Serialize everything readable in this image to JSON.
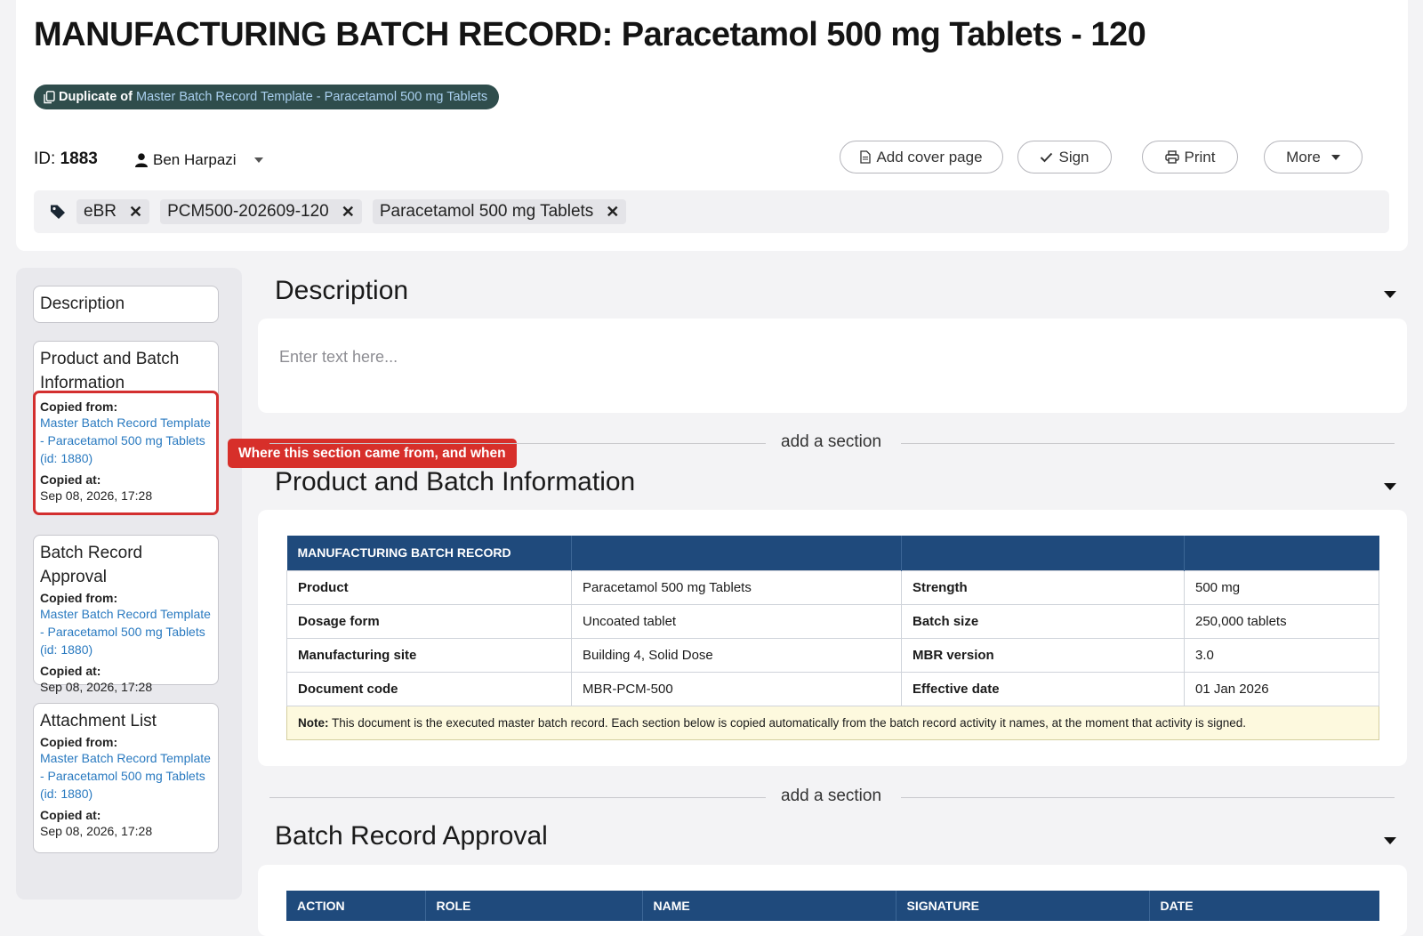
{
  "header": {
    "title": "MANUFACTURING BATCH RECORD: Paracetamol 500 mg Tablets - 120",
    "duplicate_prefix": "Duplicate of",
    "duplicate_link": "Master Batch Record Template - Paracetamol 500 mg Tablets",
    "id_label": "ID:",
    "id_value": "1883",
    "owner": "Ben Harpazi"
  },
  "toolbar": {
    "add_cover": "Add cover page",
    "sign": "Sign",
    "print": "Print",
    "more": "More"
  },
  "tags": [
    "eBR",
    "PCM500-202609-120",
    "Paracetamol 500 mg Tablets"
  ],
  "sidebar": {
    "items": [
      {
        "title": "Description"
      },
      {
        "title": "Product and Batch Information",
        "copied_from_label": "Copied from:",
        "source": "Master Batch Record Template - Paracetamol 500 mg Tablets (id: 1880)",
        "copied_at_label": "Copied at:",
        "copied_at": "Sep 08, 2026, 17:28"
      },
      {
        "title": "Batch Record Approval",
        "copied_from_label": "Copied from:",
        "source": "Master Batch Record Template - Paracetamol 500 mg Tablets (id: 1880)",
        "copied_at_label": "Copied at:",
        "copied_at": "Sep 08, 2026, 17:28"
      },
      {
        "title": "Attachment List",
        "copied_from_label": "Copied from:",
        "source": "Master Batch Record Template - Paracetamol 500 mg Tablets (id: 1880)",
        "copied_at_label": "Copied at:",
        "copied_at": "Sep 08, 2026, 17:28"
      }
    ]
  },
  "callout": "Where this section came from, and when",
  "main": {
    "add_section": "add a section",
    "description": {
      "heading": "Description",
      "placeholder": "Enter text here..."
    },
    "product": {
      "heading": "Product and Batch Information",
      "table_title": "MANUFACTURING BATCH RECORD",
      "rows": [
        [
          "Product",
          "Paracetamol 500 mg Tablets",
          "Strength",
          "500 mg"
        ],
        [
          "Dosage form",
          "Uncoated tablet",
          "Batch size",
          "250,000 tablets"
        ],
        [
          "Manufacturing site",
          "Building 4, Solid Dose",
          "MBR version",
          "3.0"
        ],
        [
          "Document code",
          "MBR-PCM-500",
          "Effective date",
          "01 Jan 2026"
        ]
      ],
      "note_label": "Note:",
      "note_text": "This document is the executed master batch record. Each section below is copied automatically from the batch record activity it names, at the moment that activity is signed."
    },
    "approval": {
      "heading": "Batch Record Approval",
      "columns": [
        "ACTION",
        "ROLE",
        "NAME",
        "SIGNATURE",
        "DATE"
      ]
    }
  }
}
